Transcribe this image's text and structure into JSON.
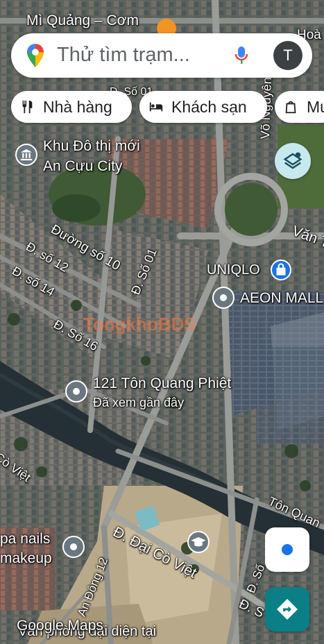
{
  "search": {
    "placeholder": "Thử tìm trạm...",
    "avatar_letter": "T"
  },
  "chips": [
    {
      "label": "Nhà hàng",
      "icon": "restaurant-icon"
    },
    {
      "label": "Khách sạn",
      "icon": "hotel-icon"
    },
    {
      "label": "Mu",
      "icon": "shopping-bag-icon"
    }
  ],
  "map_labels": {
    "top_place": "Mì Quảng – Cơm",
    "top_right": "Hoà",
    "street_so01_top": "Đ. Số 01",
    "vo_nguyen": "Võ Nguyên G",
    "van": "Văn T",
    "khu_do_thi": "Khu Đô thị mới",
    "an_cuu": "An Cựu City",
    "duong_so_10": "Đường số 10",
    "so_12": "Đ. số 12",
    "so_01": "Đ. Số 01",
    "so_14": "Đ. số 14",
    "so_16": "Đ. Số 16",
    "uniqlo": "UNIQLO",
    "aeon": "AEON MALL",
    "place_121": "121 Tôn Quang Phiệt",
    "recently_viewed": "Đã xem gần đây",
    "co_viet_left": "Cò Việt",
    "ton_quang": "Tôn Quan",
    "spa_1": "pa nails",
    "spa_2": "makeup",
    "dai_co_viet": "Đ. Đại Cò Việt",
    "an_dong_12": "An Đông 12",
    "so_bottom": "Đ. Số",
    "d_s": "Đ. S",
    "van_phong": "Văn phòng đại diện tại",
    "google_maps": "Google Maps",
    "watermark": "TongkhoBDS"
  },
  "colors": {
    "accent_blue": "#1a73e8",
    "teal": "#0b7f86",
    "pin_gray": "#6a7780"
  }
}
